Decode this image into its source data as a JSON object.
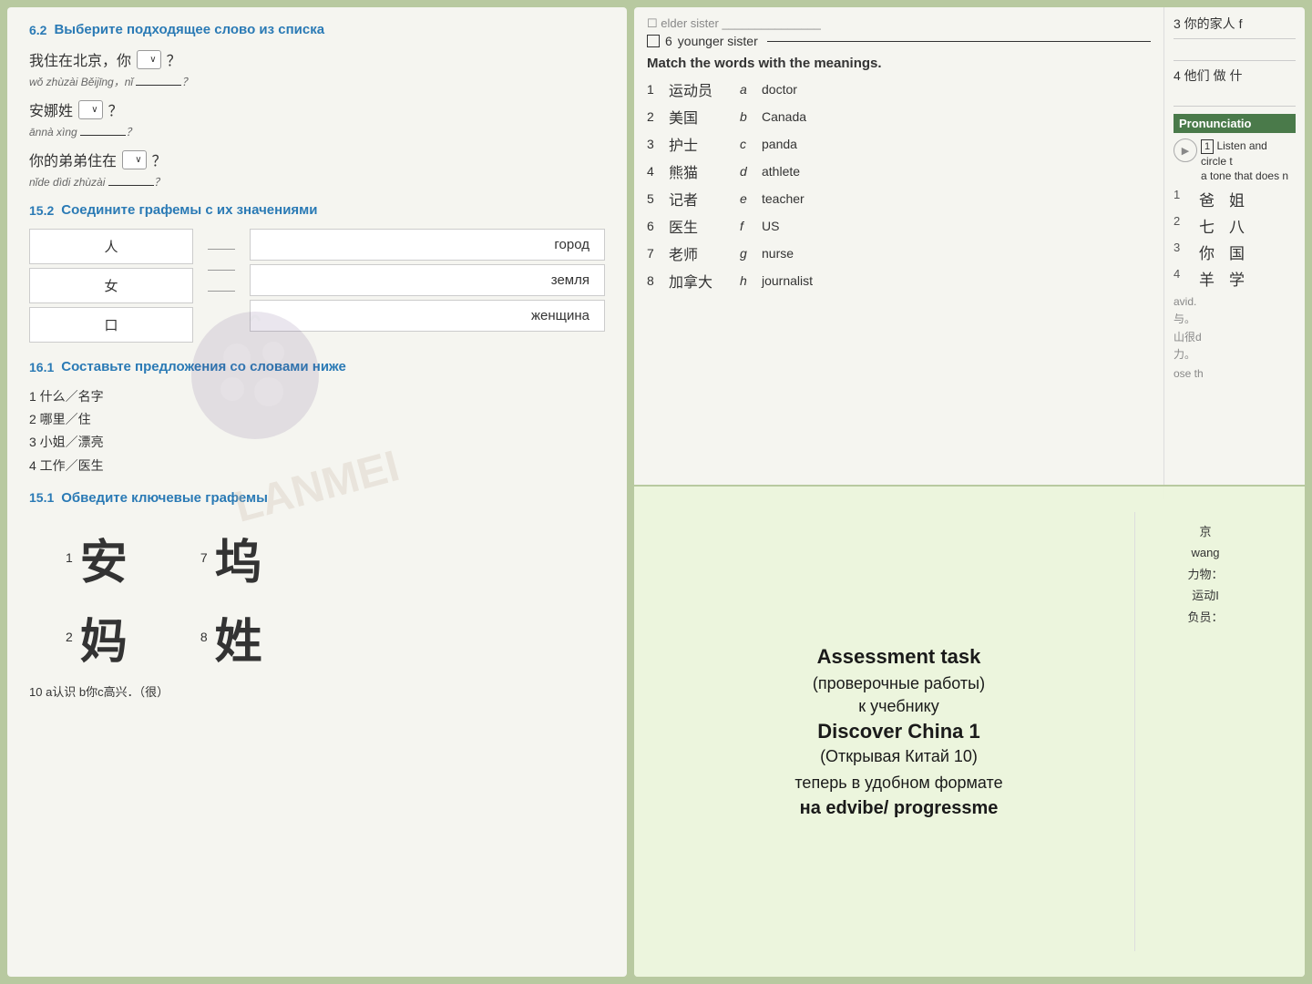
{
  "left": {
    "section62": {
      "number": "6.2",
      "title": "Выберите подходящее слово из списка",
      "sentences": [
        {
          "chinese": "我住在北京，你",
          "hasDropdown": true,
          "end": "？",
          "pinyin": "wǒ zhùzài Běijīng，nǐ ____？"
        },
        {
          "chinese": "安娜姓",
          "hasDropdown": true,
          "end": "？",
          "pinyin": "ānnà xìng ____？"
        },
        {
          "chinese": "你的弟弟住在",
          "hasDropdown": true,
          "end": "？",
          "pinyin": "nǐde dìdi zhùzài ____？"
        }
      ]
    },
    "section152": {
      "number": "15.2",
      "title": "Соедините графемы с их значениями",
      "leftItems": [
        "人",
        "女",
        "口"
      ],
      "rightItems": [
        "город",
        "земля",
        "женщина"
      ]
    },
    "section161": {
      "number": "16.1",
      "title": "Составьте предложения со словами ниже",
      "items": [
        "1 什么／名字",
        "2 哪里／住",
        "3 小姐／漂亮",
        "4 工作／医生"
      ]
    },
    "section151": {
      "number": "15.1",
      "title": "Обведите ключевые графемы",
      "chars": [
        {
          "num": "1",
          "char": "安"
        },
        {
          "num": "7",
          "char": "坞"
        },
        {
          "num": "2",
          "char": "妈"
        },
        {
          "num": "8",
          "char": "姓"
        }
      ]
    },
    "bottomText": "10  a认识  b你c高兴．（很）"
  },
  "right": {
    "checkboxItems": [
      {
        "num": "6",
        "label": "younger sister"
      }
    ],
    "matchSection": {
      "header": "Match the words with the meanings.",
      "pairs": [
        {
          "num": "1",
          "chinese": "运动员",
          "letter": "a",
          "english": "doctor"
        },
        {
          "num": "2",
          "chinese": "美国",
          "letter": "b",
          "english": "Canada"
        },
        {
          "num": "3",
          "chinese": "护士",
          "letter": "c",
          "english": "panda"
        },
        {
          "num": "4",
          "chinese": "熊猫",
          "letter": "d",
          "english": "athlete"
        },
        {
          "num": "5",
          "chinese": "记者",
          "letter": "e",
          "english": "teacher"
        },
        {
          "num": "6",
          "chinese": "医生",
          "letter": "f",
          "english": "US"
        },
        {
          "num": "7",
          "chinese": "老师",
          "letter": "g",
          "english": "nurse"
        },
        {
          "num": "8",
          "chinese": "加拿大",
          "letter": "h",
          "english": "journalist"
        }
      ]
    },
    "sideTop": {
      "line1": "3  你的家人 f",
      "line2": "",
      "line3": "4  他们 做 什",
      "line4": "___________"
    },
    "pronunciation": {
      "header": "Pronunciatio",
      "listenText": "Listen and circle t",
      "toneText": "a tone that does n",
      "numPairs": [
        {
          "num": "1",
          "chars": [
            "爸",
            "姐"
          ]
        },
        {
          "num": "2",
          "chars": [
            "七",
            "八"
          ]
        },
        {
          "num": "3",
          "chars": [
            "你",
            "国"
          ]
        }
      ]
    },
    "assessment": {
      "title": "Assessment task",
      "sub1": "(проверочные работы)",
      "sub2": "к учебнику",
      "product": "Discover China 1",
      "sub3": "(Открывая Китай 10)",
      "sub4": "теперь в удобном формате",
      "platform": "на edvibe/ progressme"
    },
    "sideRight": {
      "items": [
        "京",
        "wang",
        "力物：",
        "运动I",
        "负员："
      ]
    }
  },
  "watermark": "LANMEI"
}
